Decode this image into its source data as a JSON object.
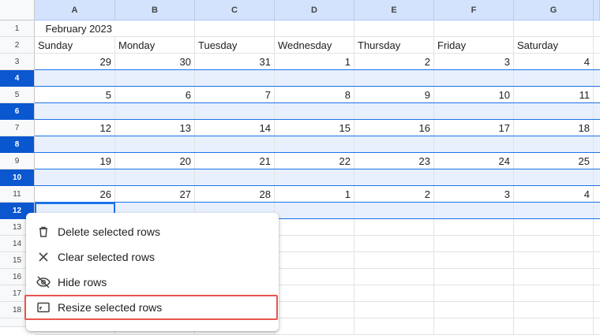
{
  "columns": [
    "A",
    "B",
    "C",
    "D",
    "E",
    "F",
    "G"
  ],
  "rows": [
    "1",
    "2",
    "3",
    "4",
    "5",
    "6",
    "7",
    "8",
    "9",
    "10",
    "11",
    "12",
    "13",
    "14",
    "15",
    "16",
    "17",
    "18"
  ],
  "cells": {
    "title": "February 2023",
    "weekdays": [
      "Sunday",
      "Monday",
      "Tuesday",
      "Wednesday",
      "Thursday",
      "Friday",
      "Saturday"
    ],
    "week1": [
      "29",
      "30",
      "31",
      "1",
      "2",
      "3",
      "4"
    ],
    "week2": [
      "5",
      "6",
      "7",
      "8",
      "9",
      "10",
      "11"
    ],
    "week3": [
      "12",
      "13",
      "14",
      "15",
      "16",
      "17",
      "18"
    ],
    "week4": [
      "19",
      "20",
      "21",
      "22",
      "23",
      "24",
      "25"
    ],
    "week5": [
      "26",
      "27",
      "28",
      "1",
      "2",
      "3",
      "4"
    ]
  },
  "selected_rows": [
    "4",
    "6",
    "8",
    "10",
    "12"
  ],
  "context_menu": {
    "items": [
      {
        "label": "Delete selected rows",
        "icon": "trash-icon"
      },
      {
        "label": "Clear selected rows",
        "icon": "close-icon"
      },
      {
        "label": "Hide rows",
        "icon": "eye-off-icon"
      },
      {
        "label": "Resize selected rows",
        "icon": "resize-icon"
      }
    ]
  },
  "colors": {
    "selection": "#1a73e8",
    "selected_row_header": "#0b57d0",
    "highlight_border": "#e8554e"
  }
}
